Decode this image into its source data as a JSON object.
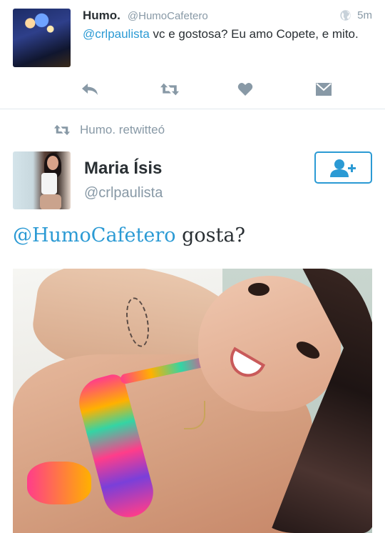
{
  "top_tweet": {
    "display_name": "Humo.",
    "handle": "@HumoCafetero",
    "time": "5m",
    "mention": "@crlpaulista",
    "text": " vc e gostosa?  Eu amo Copete, e mito.",
    "actions": {
      "reply_icon": "reply-icon",
      "retweet_icon": "retweet-icon",
      "favorite_icon": "heart-icon",
      "dm_icon": "direct-message-icon"
    }
  },
  "retweet_context": {
    "text": "Humo. retwitteó"
  },
  "retweeted_tweet": {
    "display_name": "Maria Ísis",
    "handle": "@crlpaulista",
    "mention": "@HumoCafetero",
    "text": " gosta?",
    "follow_icon": "add-user-icon"
  },
  "colors": {
    "accent": "#2b9ad4",
    "muted": "#8899a6",
    "text": "#292f33",
    "divider": "#e1e8ed"
  }
}
